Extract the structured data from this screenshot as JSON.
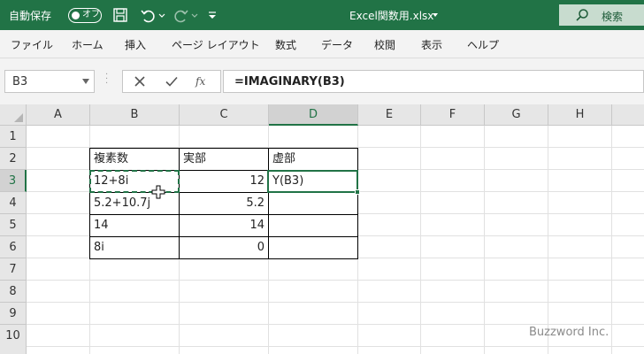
{
  "titlebar": {
    "autosave_label": "自動保存",
    "toggle_label": "オフ",
    "filename": "Excel関数用.xlsx",
    "search_label": "検索"
  },
  "ribbon": {
    "tabs": [
      "ファイル",
      "ホーム",
      "挿入",
      "ページ レイアウト",
      "数式",
      "データ",
      "校閲",
      "表示",
      "ヘルプ"
    ]
  },
  "formula_bar": {
    "name_box": "B3",
    "fx_label": "fx",
    "formula": "=IMAGINARY(B3)"
  },
  "grid": {
    "columns": [
      "A",
      "B",
      "C",
      "D",
      "E",
      "F",
      "G",
      "H"
    ],
    "rows": [
      "1",
      "2",
      "3",
      "4",
      "5",
      "6",
      "7",
      "8",
      "9",
      "10"
    ],
    "selected_column": "D",
    "selected_row": "3"
  },
  "table": {
    "headers": [
      "複素数",
      "実部",
      "虚部"
    ],
    "rows": [
      [
        "12+8i",
        "12",
        "Y(B3)"
      ],
      [
        "5.2+10.7j",
        "5.2",
        ""
      ],
      [
        "14",
        "14",
        ""
      ],
      [
        "8i",
        "0",
        ""
      ]
    ]
  },
  "watermark": "Buzzword Inc.",
  "colors": {
    "excel_green": "#217346",
    "ribbon_bg": "#f3f3f3",
    "header_bg": "#e6e6e6"
  }
}
